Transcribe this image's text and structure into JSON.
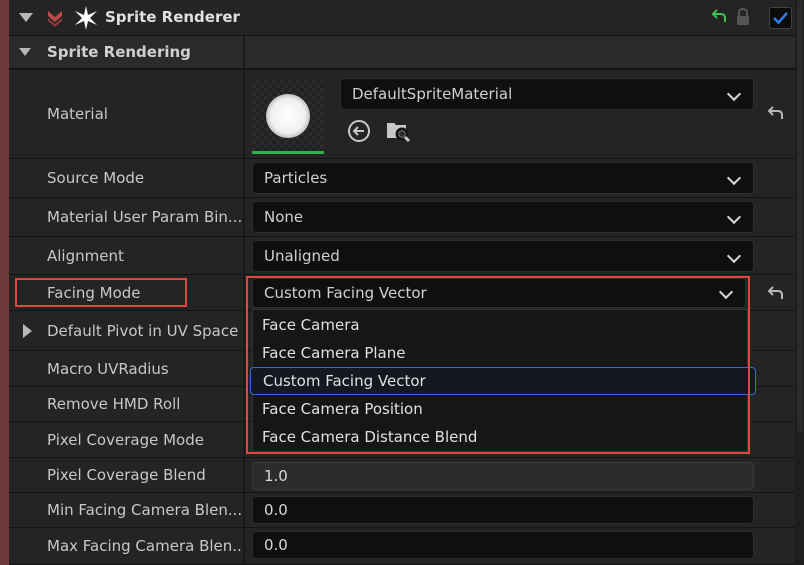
{
  "header": {
    "title": "Sprite Renderer",
    "enabled": true
  },
  "section": {
    "title": "Sprite Rendering"
  },
  "rows": {
    "material": {
      "label": "Material",
      "value": "DefaultSpriteMaterial"
    },
    "source_mode": {
      "label": "Source Mode",
      "value": "Particles"
    },
    "material_user_param": {
      "label": "Material User Param Bin...",
      "value": "None"
    },
    "alignment": {
      "label": "Alignment",
      "value": "Unaligned"
    },
    "facing_mode": {
      "label": "Facing Mode",
      "value": "Custom Facing Vector"
    },
    "default_pivot": {
      "label": "Default Pivot in UV Space"
    },
    "macro_uvradius": {
      "label": "Macro UVRadius"
    },
    "remove_hmd_roll": {
      "label": "Remove HMD Roll"
    },
    "pixel_coverage_mode": {
      "label": "Pixel Coverage Mode"
    },
    "pixel_coverage_blend": {
      "label": "Pixel Coverage Blend",
      "value": "1.0"
    },
    "min_facing": {
      "label": "Min Facing Camera Blen...",
      "value": "0.0"
    },
    "max_facing": {
      "label": "Max Facing Camera Blen...",
      "value": "0.0"
    }
  },
  "dropdown": {
    "options": [
      "Face Camera",
      "Face Camera Plane",
      "Custom Facing Vector",
      "Face Camera Position",
      "Face Camera Distance Blend"
    ],
    "selected": "Custom Facing Vector"
  },
  "colors": {
    "highlight": "#e0463e",
    "selection": "#2f6fd1",
    "green_indicator": "#2fb34a",
    "checkbox_blue": "#2e7de0"
  }
}
